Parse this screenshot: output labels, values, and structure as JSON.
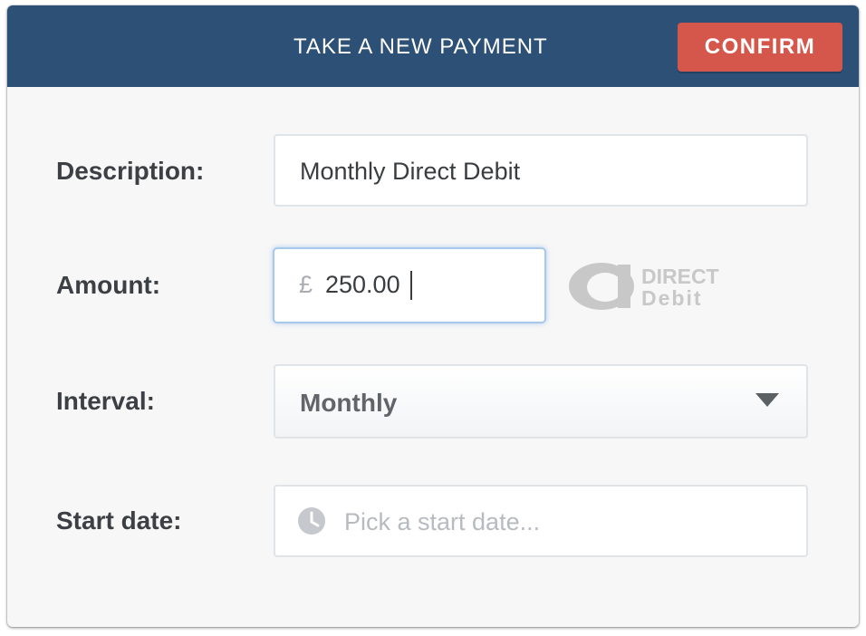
{
  "header": {
    "title": "TAKE A NEW PAYMENT",
    "confirm_label": "CONFIRM"
  },
  "form": {
    "description": {
      "label": "Description:",
      "value": "Monthly Direct Debit"
    },
    "amount": {
      "label": "Amount:",
      "currency_symbol": "£",
      "value": "250.00"
    },
    "interval": {
      "label": "Interval:",
      "selected": "Monthly"
    },
    "start_date": {
      "label": "Start date:",
      "placeholder": "Pick a start date..."
    }
  },
  "direct_debit_logo": {
    "line1": "DIRECT",
    "line2": "Debit"
  },
  "icons": {
    "dropdown": "chevron-down-icon",
    "start_date": "clock-icon",
    "logo": "direct-debit-logo"
  },
  "colors": {
    "header_bg": "#2d5076",
    "confirm_bg": "#d5574b",
    "focus_border": "#a8c8ec",
    "label_text": "#3c4045"
  }
}
